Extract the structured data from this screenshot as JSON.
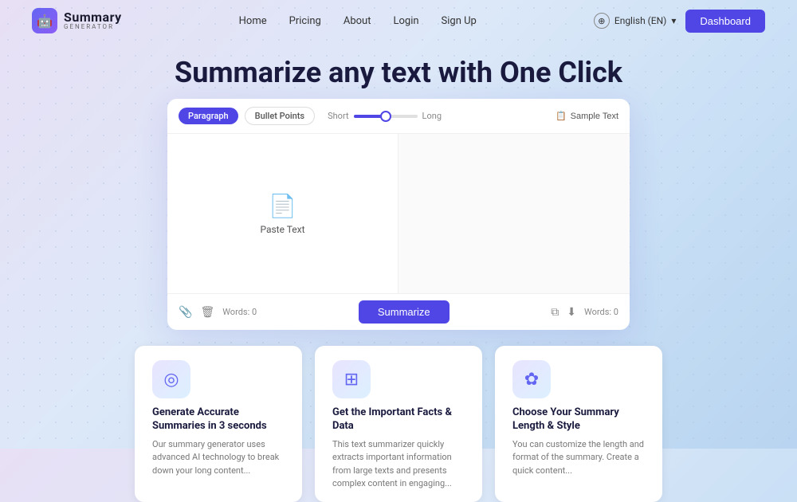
{
  "navbar": {
    "logo_title": "Summary",
    "logo_sub": "GENERATOR",
    "links": [
      {
        "label": "Home",
        "id": "home"
      },
      {
        "label": "Pricing",
        "id": "pricing"
      },
      {
        "label": "About",
        "id": "about"
      },
      {
        "label": "Login",
        "id": "login"
      },
      {
        "label": "Sign Up",
        "id": "signup"
      }
    ],
    "lang_text": "English (EN)",
    "dashboard_label": "Dashboard"
  },
  "hero": {
    "title": "Summarize any text with One Click"
  },
  "card": {
    "tab_paragraph": "Paragraph",
    "tab_bullets": "Bullet Points",
    "slider_short": "Short",
    "slider_long": "Long",
    "sample_text_label": "Sample Text",
    "paste_label": "Paste Text",
    "word_count_input": "Words: 0",
    "word_count_output": "Words: 0",
    "summarize_label": "Summarize"
  },
  "features": [
    {
      "id": "feature-accurate",
      "icon": "◎",
      "title": "Generate Accurate Summaries in 3 seconds",
      "desc": "Our summary generator uses advanced AI technology to break down your long content..."
    },
    {
      "id": "feature-facts",
      "icon": "⊞",
      "title": "Get the Important Facts & Data",
      "desc": "This text summarizer quickly extracts important information from large texts and presents complex content in engaging..."
    },
    {
      "id": "feature-style",
      "icon": "✿",
      "title": "Choose Your Summary Length & Style",
      "desc": "You can customize the length and format of the summary. Create a quick content..."
    }
  ]
}
